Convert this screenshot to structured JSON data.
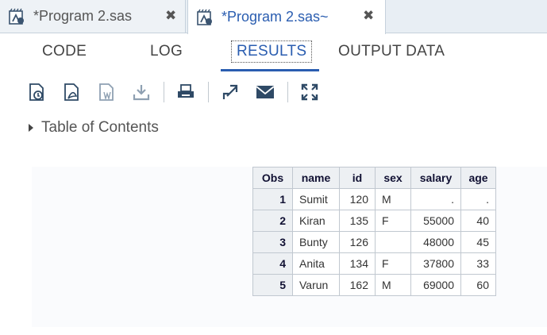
{
  "tabs": [
    {
      "title": "*Program 2.sas",
      "close": "✖",
      "active": false
    },
    {
      "title": "*Program 2.sas~",
      "close": "✖",
      "active": true
    }
  ],
  "subtabs": [
    "CODE",
    "LOG",
    "RESULTS",
    "OUTPUT DATA"
  ],
  "active_subtab": "RESULTS",
  "toolbar": [
    "html-download-icon",
    "pdf-download-icon",
    "rtf-download-icon",
    "download-icon",
    "print-icon",
    "open-new-window-icon",
    "email-icon",
    "maximize-icon"
  ],
  "toc_label": "Table of Contents",
  "table": {
    "columns": [
      "Obs",
      "name",
      "id",
      "sex",
      "salary",
      "age"
    ],
    "rows": [
      [
        "1",
        "Sumit",
        "120",
        "M",
        ".",
        "."
      ],
      [
        "2",
        "Kiran",
        "135",
        "F",
        "55000",
        "40"
      ],
      [
        "3",
        "Bunty",
        "126",
        "",
        "48000",
        "45"
      ],
      [
        "4",
        "Anita",
        "134",
        "F",
        "37800",
        "33"
      ],
      [
        "5",
        "Varun",
        "162",
        "M",
        "69000",
        "60"
      ]
    ]
  },
  "colors": {
    "accent": "#2a5db0",
    "header_bg": "#edf0f3",
    "tabstrip_bg": "#e8eef4"
  }
}
